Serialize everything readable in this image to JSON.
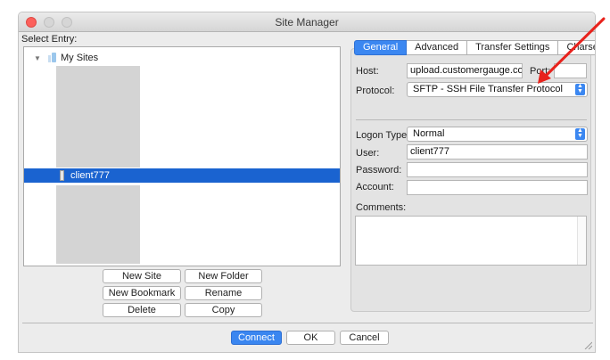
{
  "window": {
    "title": "Site Manager",
    "select_entry": "Select Entry:"
  },
  "tree": {
    "root_label": "My Sites",
    "selected_label": "client777"
  },
  "site_buttons": {
    "new_site": "New Site",
    "new_folder": "New Folder",
    "new_bookmark": "New Bookmark",
    "rename": "Rename",
    "delete": "Delete",
    "copy": "Copy"
  },
  "tabs": [
    {
      "label": "General",
      "active": true
    },
    {
      "label": "Advanced",
      "active": false
    },
    {
      "label": "Transfer Settings",
      "active": false
    },
    {
      "label": "Charset",
      "active": false
    }
  ],
  "general": {
    "host_label": "Host:",
    "host_value": "upload.customergauge.co",
    "port_label": "Port:",
    "port_value": "",
    "protocol_label": "Protocol:",
    "protocol_value": "SFTP - SSH File Transfer Protocol",
    "logon_type_label": "Logon Type:",
    "logon_type_value": "Normal",
    "user_label": "User:",
    "user_value": "client777",
    "password_label": "Password:",
    "password_value": "",
    "account_label": "Account:",
    "account_value": "",
    "comments_label": "Comments:"
  },
  "dialog_buttons": {
    "connect": "Connect",
    "ok": "OK",
    "cancel": "Cancel"
  },
  "colors": {
    "accent": "#3b87f1",
    "selection": "#1a63d0",
    "annotation_arrow": "#e8221c"
  }
}
